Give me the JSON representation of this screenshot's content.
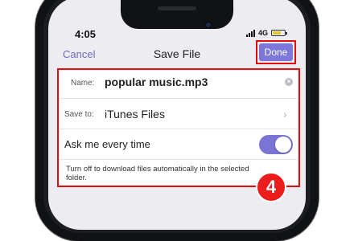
{
  "status_bar": {
    "time": "4:05",
    "network": "4G"
  },
  "nav": {
    "cancel_label": "Cancel",
    "title": "Save File",
    "done_label": "Done"
  },
  "form": {
    "name_label": "Name:",
    "name_value": "popular music.mp3",
    "save_to_label": "Save to:",
    "save_to_value": "iTunes Files",
    "ask_label": "Ask me every time",
    "ask_enabled": true,
    "hint": "Turn off to download files automatically in the selected folder."
  },
  "annotation": {
    "step": "4"
  },
  "colors": {
    "accent": "#7e76d8",
    "highlight": "#e01010",
    "badge": "#ea1c1c"
  }
}
